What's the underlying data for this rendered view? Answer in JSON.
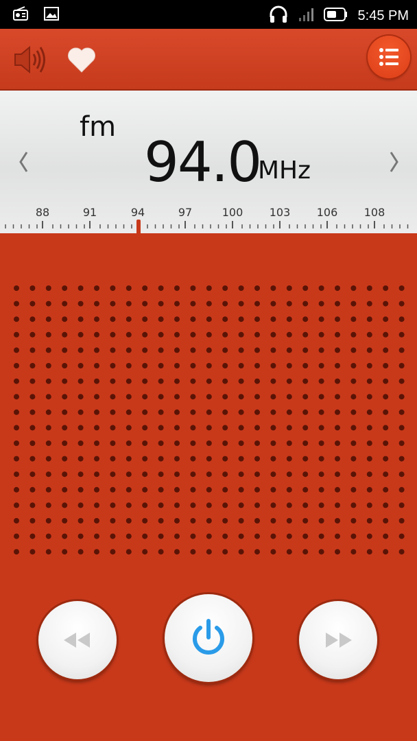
{
  "status_bar": {
    "time": "5:45 PM",
    "icons": [
      "radio-icon",
      "image-icon",
      "headphones-icon",
      "signal-icon",
      "battery-icon"
    ]
  },
  "toolbar": {
    "icons": [
      "speaker-icon",
      "heart-icon",
      "list-menu-icon"
    ]
  },
  "tuner": {
    "band": "fm",
    "frequency": "94.0",
    "unit": "MHz",
    "scale_labels": [
      "88",
      "91",
      "94",
      "97",
      "100",
      "103",
      "106",
      "108"
    ]
  },
  "controls": {
    "icons": [
      "rewind-icon",
      "power-icon",
      "fast-forward-icon"
    ]
  },
  "colors": {
    "accent": "#c8391a",
    "power_blue": "#2a9be8"
  }
}
